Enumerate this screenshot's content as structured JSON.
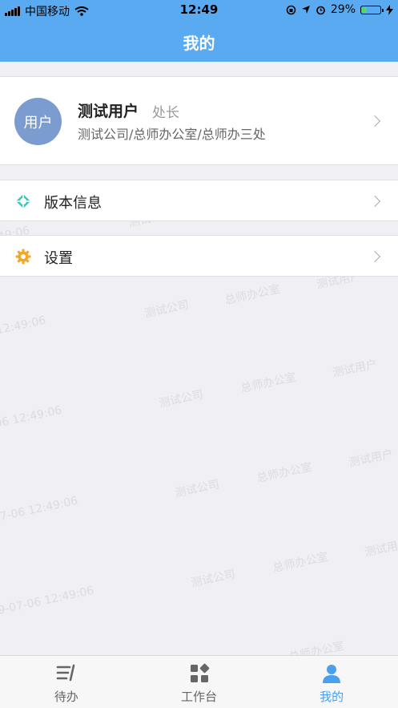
{
  "status_bar": {
    "carrier": "中国移动",
    "time": "12:49",
    "battery_pct": "29%",
    "battery_level": 0.29
  },
  "header": {
    "title": "我的"
  },
  "profile": {
    "avatar_text": "用户",
    "name": "测试用户",
    "position": "处长",
    "org": "测试公司/总师办公室/总师办三处"
  },
  "menu": {
    "version_label": "版本信息",
    "settings_label": "设置"
  },
  "tabs": [
    {
      "label": "待办"
    },
    {
      "label": "工作台"
    },
    {
      "label": "我的"
    }
  ],
  "watermark": {
    "user": "测试用户",
    "company": "测试公司",
    "dept": "总师办公室",
    "timestamp": "2019-07-06 12:49:06"
  },
  "colors": {
    "nav_bg": "#5aaaf2",
    "accent": "#4a9ff0",
    "avatar_bg": "#7a9ccf",
    "settings_icon": "#f5a623",
    "version_icon": "#3ec7b8"
  }
}
